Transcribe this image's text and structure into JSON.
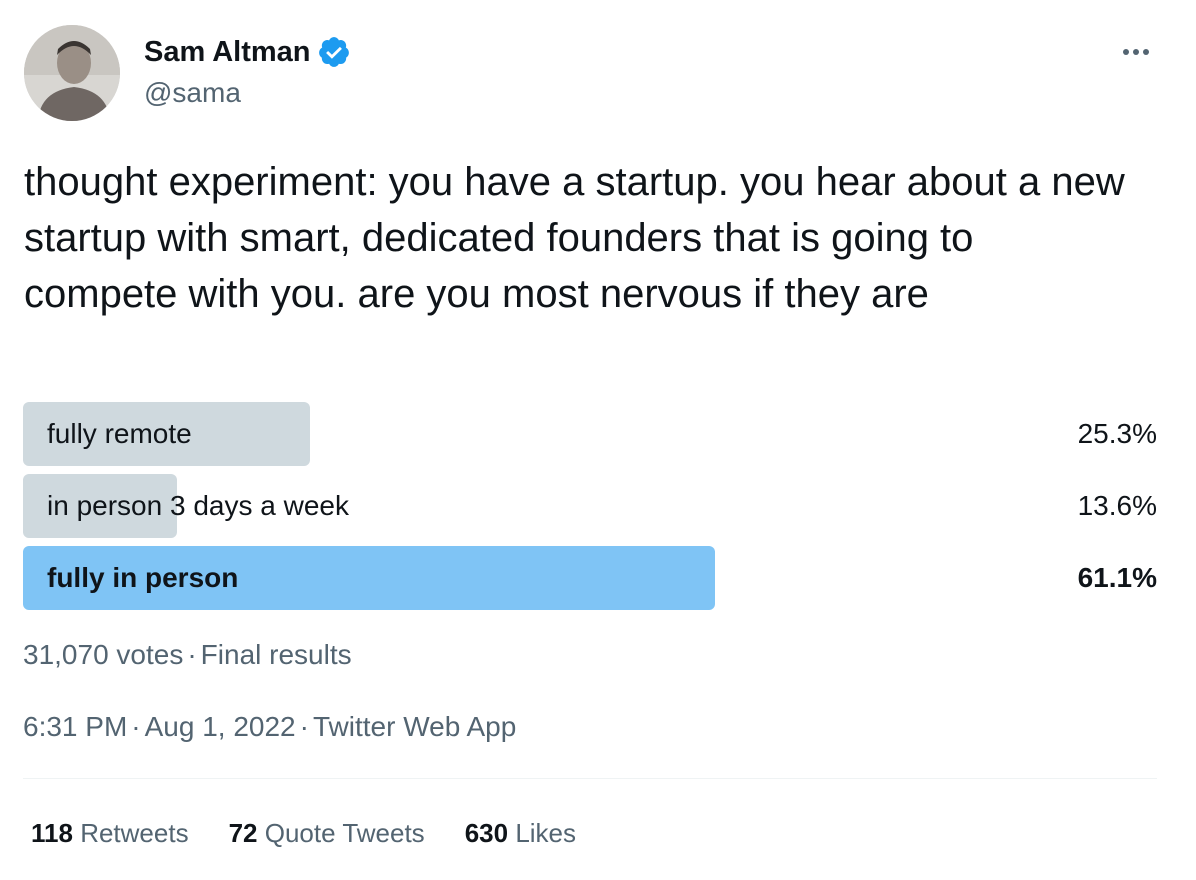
{
  "author": {
    "name": "Sam Altman",
    "handle": "@sama",
    "verified_color": "#1d9bf0"
  },
  "icons": {
    "verified": "verified-badge-icon",
    "more": "more-options-icon"
  },
  "tweet": {
    "text": "thought experiment: you have a startup. you hear about a new startup with smart, dedicated founders that is going to compete with you. are you most nervous if they are"
  },
  "poll": {
    "options": [
      {
        "label": "fully remote",
        "percent": "25.3%",
        "share": 0.253,
        "winner": false
      },
      {
        "label": "in person 3 days a week",
        "percent": "13.6%",
        "share": 0.136,
        "winner": false
      },
      {
        "label": "fully in person",
        "percent": "61.1%",
        "share": 0.611,
        "winner": true
      }
    ],
    "votes": "31,070 votes",
    "status": "Final results",
    "bar_color": "#cfd9de",
    "winner_color": "#7fc4f5"
  },
  "meta": {
    "time": "6:31 PM",
    "date": "Aug 1, 2022",
    "source": "Twitter Web App"
  },
  "stats": {
    "retweets_count": "118",
    "retweets_label": "Retweets",
    "quotes_count": "72",
    "quotes_label": "Quote Tweets",
    "likes_count": "630",
    "likes_label": "Likes"
  }
}
